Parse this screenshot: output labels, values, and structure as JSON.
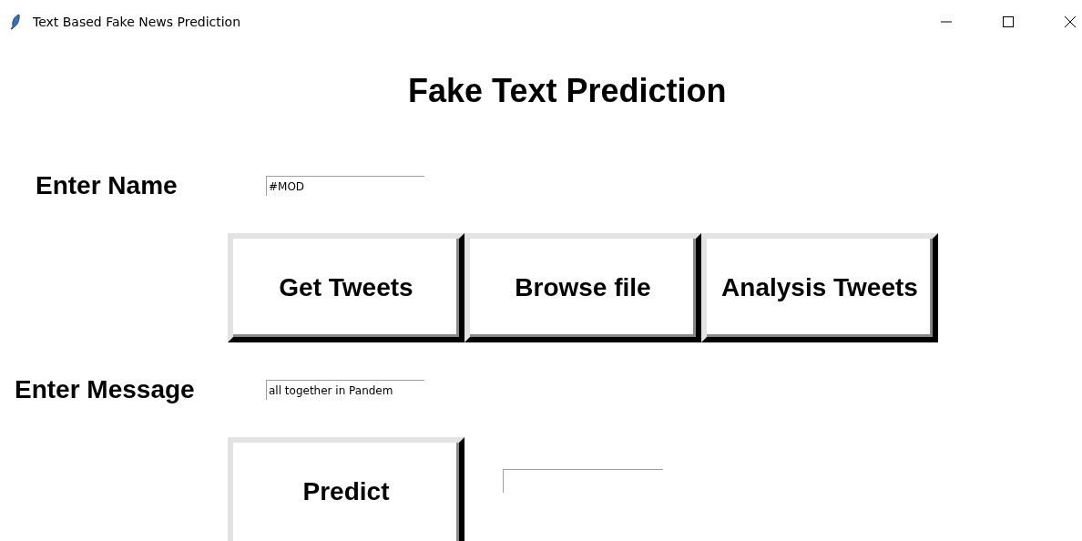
{
  "window": {
    "title": "Text Based Fake News Prediction"
  },
  "heading": "Fake Text Prediction",
  "name_field": {
    "label": "Enter Name",
    "value": "#MOD"
  },
  "buttons": [
    "Get Tweets",
    "Browse file",
    "Analysis Tweets"
  ],
  "message_field": {
    "label": "Enter Message",
    "value": "all together in Pandem"
  },
  "predict_button": "Predict"
}
